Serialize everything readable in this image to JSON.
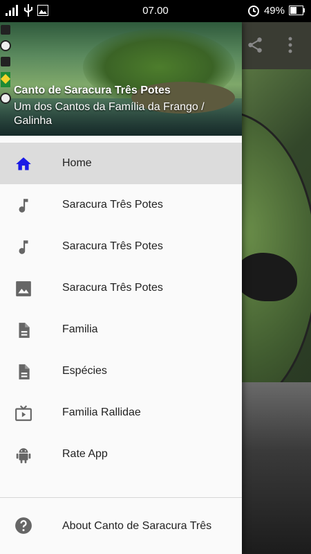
{
  "status_bar": {
    "time": "07.00",
    "battery": "49%",
    "icons": [
      "signal-icon",
      "usb-icon",
      "image-icon",
      "alarm-icon",
      "battery-icon"
    ]
  },
  "drawer": {
    "header": {
      "title": "Canto de Saracura Três Potes",
      "subtitle": "Um dos Cantos da Família da Frango / Galinha"
    },
    "items": [
      {
        "label": "Home",
        "icon": "home-icon",
        "active": true
      },
      {
        "label": "Saracura Três Potes",
        "icon": "music-note-icon"
      },
      {
        "label": "Saracura Três Potes",
        "icon": "music-note-icon"
      },
      {
        "label": "Saracura Três Potes",
        "icon": "image-icon"
      },
      {
        "label": "Familia",
        "icon": "document-icon"
      },
      {
        "label": "Espécies",
        "icon": "document-icon"
      },
      {
        "label": "Familia Rallidae",
        "icon": "tv-icon"
      },
      {
        "label": "Rate App",
        "icon": "android-icon"
      }
    ],
    "about": {
      "label": "About Canto de Saracura Três",
      "icon": "help-icon"
    }
  },
  "toolbar": {
    "icons": [
      "share-icon",
      "more-vert-icon"
    ]
  },
  "colors": {
    "active_icon": "#1a1ae6",
    "icon": "#666666",
    "active_bg": "#dcdcdc"
  }
}
